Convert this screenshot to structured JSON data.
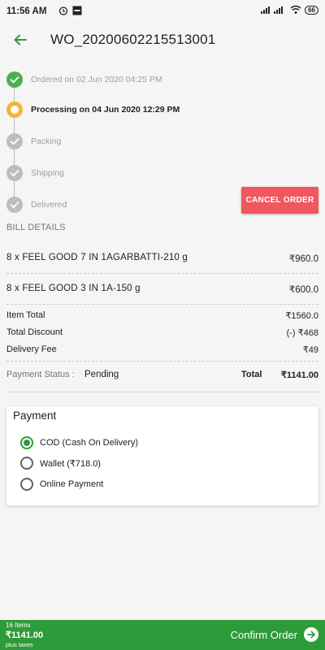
{
  "status_bar": {
    "time": "11:56 AM",
    "battery": "66"
  },
  "header": {
    "title": "WO_20200602215513001"
  },
  "timeline": {
    "steps": [
      {
        "label": "Ordered on 02 Jun 2020 04:25 PM",
        "state": "done"
      },
      {
        "label": "Processing on 04 Jun 2020 12:29 PM",
        "state": "current"
      },
      {
        "label": "Packing",
        "state": "pending"
      },
      {
        "label": "Shipping",
        "state": "pending"
      },
      {
        "label": "Delivered",
        "state": "pending"
      }
    ],
    "cancel_label": "CANCEL ORDER"
  },
  "bill": {
    "heading": "BILL DETAILS",
    "items": [
      {
        "name": "8 x FEEL GOOD 7 IN 1AGARBATTI-210 g",
        "price": "₹960.0"
      },
      {
        "name": "8 x FEEL GOOD 3 IN 1A-150 g",
        "price": "₹600.0"
      }
    ],
    "summary": [
      {
        "label": "Item Total",
        "value": "₹1560.0"
      },
      {
        "label": "Total Discount",
        "value": "(-) ₹468"
      },
      {
        "label": "Delivery Fee",
        "value": "₹49"
      }
    ],
    "payment_status_label": "Payment Status :",
    "payment_status_value": "Pending",
    "total_label": "Total",
    "total_value": "₹1141.00"
  },
  "payment": {
    "heading": "Payment",
    "options": [
      {
        "label": "COD (Cash On Delivery)",
        "selected": true
      },
      {
        "label": "Wallet (₹718.0)",
        "selected": false
      },
      {
        "label": "Online Payment",
        "selected": false
      }
    ]
  },
  "footer": {
    "items_count": "16 Items",
    "amount": "₹1141.00",
    "tax_note": "plus taxes",
    "confirm_label": "Confirm Order"
  },
  "colors": {
    "accent_green": "#2e9b3a",
    "done_green": "#4caf50",
    "current_yellow": "#f5b433",
    "cancel_red": "#f0575f"
  }
}
